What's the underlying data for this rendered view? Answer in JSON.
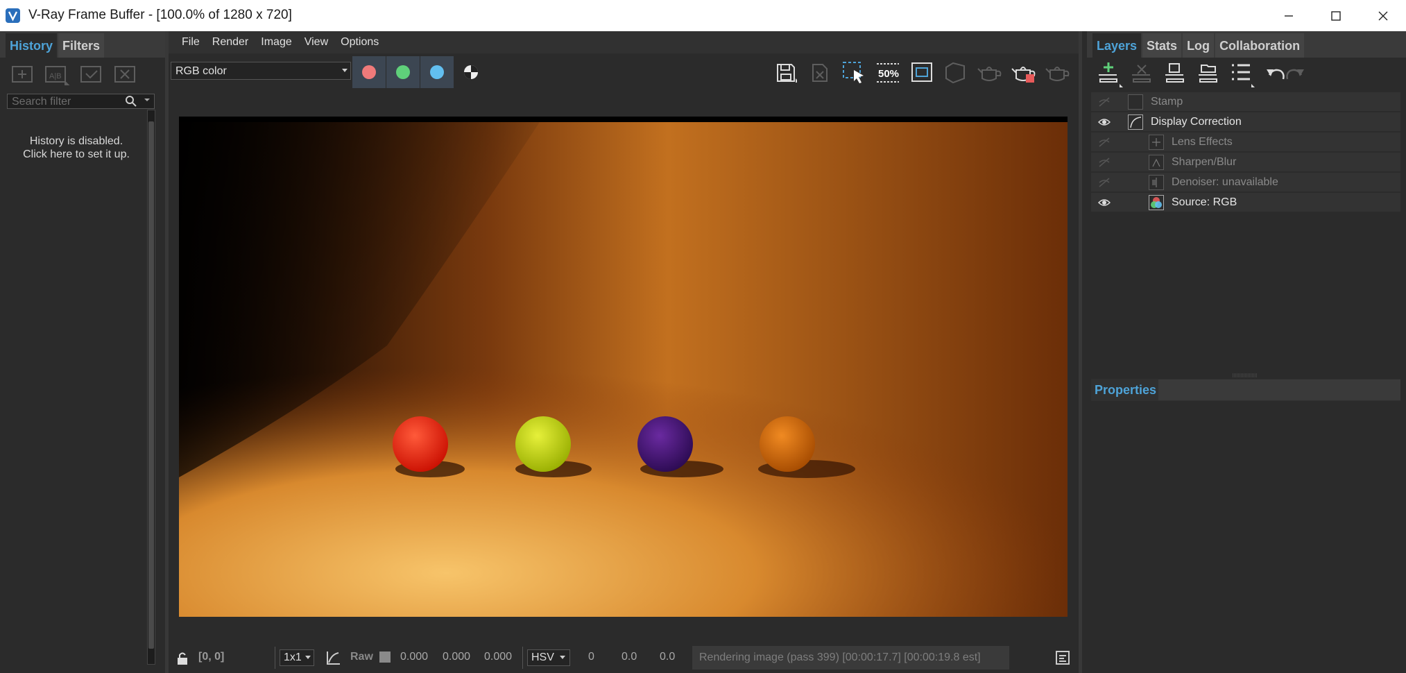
{
  "window": {
    "title": "V-Ray Frame Buffer - [100.0% of 1280 x 720]"
  },
  "left_panel": {
    "tabs": [
      "History",
      "Filters"
    ],
    "search_placeholder": "Search filter",
    "history_message_line1": "History is disabled.",
    "history_message_line2": "Click here to set it up."
  },
  "menu": [
    "File",
    "Render",
    "Image",
    "View",
    "Options"
  ],
  "toolbar": {
    "channel": "RGB color",
    "zoom_label": "50%"
  },
  "status": {
    "coords": "[0, 0]",
    "sample_size": "1x1",
    "raw_label": "Raw",
    "rgb_values": [
      "0.000",
      "0.000",
      "0.000"
    ],
    "color_space": "HSV",
    "hsv_values": [
      "0",
      "0.0",
      "0.0"
    ],
    "message": "Rendering image (pass 399) [00:00:17.7] [00:00:19.8 est]"
  },
  "right_panel": {
    "tabs": [
      "Layers",
      "Stats",
      "Log",
      "Collaboration"
    ],
    "layers": [
      {
        "name": "Stamp",
        "visible": false,
        "indent": 0
      },
      {
        "name": "Display Correction",
        "visible": true,
        "indent": 0
      },
      {
        "name": "Lens Effects",
        "visible": false,
        "indent": 1
      },
      {
        "name": "Sharpen/Blur",
        "visible": false,
        "indent": 1
      },
      {
        "name": "Denoiser: unavailable",
        "visible": false,
        "indent": 1
      },
      {
        "name": "Source: RGB",
        "visible": true,
        "indent": 1
      }
    ],
    "properties_label": "Properties"
  },
  "colors": {
    "accent": "#4ea3d8",
    "red_channel": "#f07a7a",
    "green_channel": "#5fd07a",
    "blue_channel": "#62bff0"
  }
}
